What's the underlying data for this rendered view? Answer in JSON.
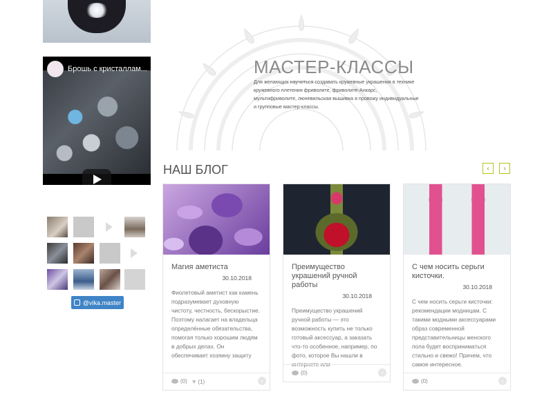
{
  "sidebar": {
    "video": {
      "title": "Брошь с кристаллам..."
    },
    "instagram_button": {
      "label": "@vika.master",
      "color": "#3f84c6"
    }
  },
  "master_classes": {
    "title": "МАСТЕР-КЛАССЫ",
    "text": "Для желающих научиться создавать кружевные украшения в технике кружевного плетения фриволите, фриволите-Анкарс, мультифриволите, люневильская вышивка я провожу индивидуальные и групповые мастер-классы."
  },
  "blog": {
    "title": "НАШ БЛОГ",
    "prev_label": "‹",
    "next_label": "›",
    "accent_color": "#b5c21d",
    "posts": [
      {
        "title": "Магия аметиста",
        "date": "30.10.2018",
        "excerpt": "Фиолетовый аметист как камень подразумевает духовную чистоту, честность, бескорыстие. Поэтому налагает на владельца определённые обязательства, помогая только хорошим людям в добрых делах.   Он обеспечивает хозяину защиту",
        "comments": "(0)",
        "likes": "(1)"
      },
      {
        "title": "Преимущество украшений ручной работы",
        "date": "30.10.2018",
        "excerpt": "Преимущество украшений ручной работы — это возможность купить не только готовый аксессуар, а заказать что-то особенное, например, по фото, которое Вы нашли в интернете или",
        "comments": "(0)"
      },
      {
        "title": "С чем носить серьги кисточки.",
        "date": "30.10.2018",
        "excerpt": "С чем носить серьги кисточки: рекомендации модницам. С такими модными аксессуарами образ современной представительницы женского пола будет восприниматься стильно и свежо! Причем, что самое интересное.",
        "comments": "(0)"
      }
    ]
  }
}
